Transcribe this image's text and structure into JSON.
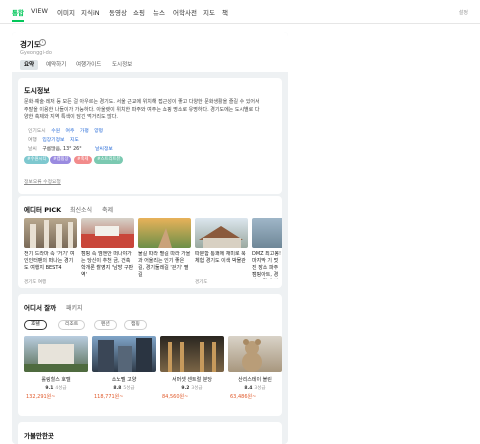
{
  "nav": {
    "tabs": [
      "통합",
      "VIEW",
      "이미지",
      "지식iN",
      "동영상",
      "쇼핑",
      "뉴스",
      "어학사전",
      "지도",
      "책"
    ],
    "settings": "설정"
  },
  "place": {
    "title": "경기도",
    "info_icon": "i",
    "roman": "Gyeonggi-do",
    "subtabs": [
      "요약",
      "예약하기",
      "여행가이드",
      "도시정보"
    ]
  },
  "intro": {
    "title": "도시정보",
    "text": "문화·예술·레저 등 모든 걸 아우르는 경기도. 서울 근교에 위치해 접근성이 좋고 다양한 문화생활을 즐길 수 있어서 주말을 이용한 나들이가 가능하다. 아울렛이 위치한 파주와 여주는 쇼핑 명소로 유명하다. 경기도에는 도시별로 다양한 축제와 지역 특색이 담긴 먹거리도 많다.",
    "rows": [
      {
        "label": "인기도시",
        "links": [
          "수원",
          "여주",
          "가평",
          "양평"
        ]
      },
      {
        "label": "여행",
        "links": [
          "입장기정보",
          "지도"
        ]
      },
      {
        "label": "날씨",
        "value": "구름많음, 13° 26°",
        "link": "날씨정보"
      }
    ],
    "tags": [
      {
        "text": "#수원시티",
        "color": "#7ec8cf"
      },
      {
        "text": "#캠핑장",
        "color": "#9a8be0"
      },
      {
        "text": "#축제",
        "color": "#f28b8b"
      },
      {
        "text": "#스트리트뷰",
        "color": "#7bc9b1"
      }
    ],
    "report": "정보오류 수정요청"
  },
  "pick": {
    "title": "에디터 PICK",
    "tabs": [
      "최신소식",
      "축제"
    ],
    "items": [
      {
        "title": "전기 드라마 속 '거기' 여인인터팬의 떠나는 경기도 여행지 BEST4",
        "source": "경기도 여행"
      },
      {
        "title": "캠핑 속 엠엔안 떠나야가는 당신이 추천 금, 건축학개론 촬영지 '남방 구판역'",
        "source": ""
      },
      {
        "title": "물길 따라 펼길 따라 가을과 어울리는 인기 좋은 길, 경기둘레길 '걷기' 펼길",
        "source": ""
      },
      {
        "title": "따분함 통쾌에 재미로 북 체험 경기도 이색 박물관",
        "source": "경기도"
      },
      {
        "title": "DMZ 최고봉! 마지막 기 멋진 장소 파주 캠핑아트, 경기도 경제 박물 관 (with 경기도)",
        "source": ""
      }
    ]
  },
  "stay": {
    "title": "어디서 잘까",
    "tab2": "패키지",
    "chips": [
      "호텔",
      "리조트",
      "펜션",
      "캠핑"
    ],
    "hotels": [
      {
        "name": "롤링힐스 호텔",
        "score": "9.1",
        "grade": "4성급",
        "price": "132,291원~"
      },
      {
        "name": "소노펠 고양",
        "score": "8.8",
        "grade": "5성급",
        "price": "118,771원~"
      },
      {
        "name": "서머셋 센트럴 분당",
        "score": "9.2",
        "grade": "3성급",
        "price": "84,560원~"
      },
      {
        "name": "산리스테이 블린",
        "score": "8.4",
        "grade": "3성급",
        "price": "63,486원~"
      }
    ]
  },
  "more": {
    "title": "가볼만한곳"
  }
}
